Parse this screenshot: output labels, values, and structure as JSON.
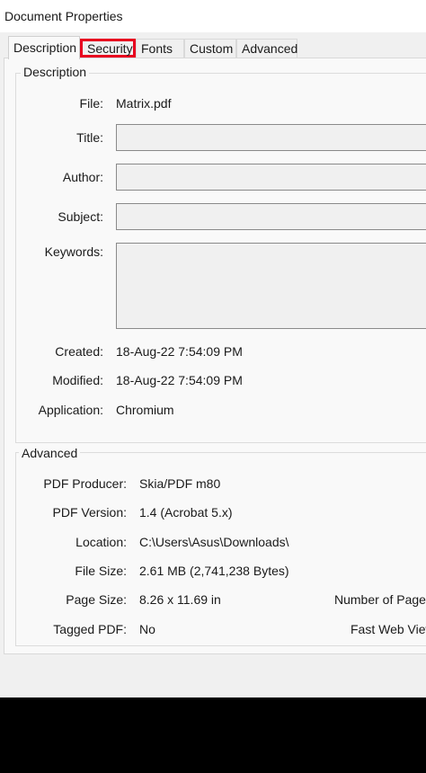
{
  "window": {
    "title": "Document Properties"
  },
  "tabs": [
    {
      "label": "Description"
    },
    {
      "label": "Security"
    },
    {
      "label": "Fonts"
    },
    {
      "label": "Custom"
    },
    {
      "label": "Advanced"
    }
  ],
  "description": {
    "legend": "Description",
    "file": {
      "label": "File:",
      "value": "Matrix.pdf"
    },
    "title": {
      "label": "Title:",
      "value": ""
    },
    "author": {
      "label": "Author:",
      "value": ""
    },
    "subject": {
      "label": "Subject:",
      "value": ""
    },
    "keywords": {
      "label": "Keywords:",
      "value": ""
    },
    "created": {
      "label": "Created:",
      "value": "18-Aug-22 7:54:09 PM"
    },
    "modified": {
      "label": "Modified:",
      "value": "18-Aug-22 7:54:09 PM"
    },
    "application": {
      "label": "Application:",
      "value": "Chromium"
    }
  },
  "advanced": {
    "legend": "Advanced",
    "producer": {
      "label": "PDF Producer:",
      "value": "Skia/PDF m80"
    },
    "version": {
      "label": "PDF Version:",
      "value": "1.4 (Acrobat 5.x)"
    },
    "location": {
      "label": "Location:",
      "value": "C:\\Users\\Asus\\Downloads\\"
    },
    "file_size": {
      "label": "File Size:",
      "value": "2.61 MB (2,741,238 Bytes)"
    },
    "page_size": {
      "label": "Page Size:",
      "value": "8.26 x 11.69 in"
    },
    "tagged": {
      "label": "Tagged PDF:",
      "value": "No"
    },
    "num_pages_label": "Number of Pages:",
    "fast_web_label": "Fast Web View:"
  }
}
